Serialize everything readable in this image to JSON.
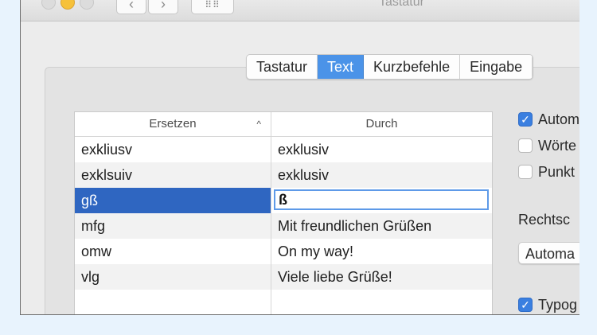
{
  "window": {
    "title": "Tastatur",
    "nav_back_icon": "‹",
    "nav_forward_icon": "›",
    "grid_icon": "⠿⠿"
  },
  "tabs": [
    {
      "label": "Tastatur",
      "selected": false
    },
    {
      "label": "Text",
      "selected": true
    },
    {
      "label": "Kurzbefehle",
      "selected": false
    },
    {
      "label": "Eingabe",
      "selected": false
    }
  ],
  "table": {
    "headers": {
      "replace": "Ersetzen",
      "with": "Durch"
    },
    "sort_icon": "^",
    "rows": [
      {
        "replace": "exkliusv",
        "with": "exklusiv"
      },
      {
        "replace": "exklsuiv",
        "with": "exklusiv"
      },
      {
        "replace": "gß",
        "with": "ß",
        "selected": true,
        "editing": true
      },
      {
        "replace": "mfg",
        "with": "Mit freundlichen Grüßen"
      },
      {
        "replace": "omw",
        "with": "On my way!"
      },
      {
        "replace": "vlg",
        "with": "Viele liebe Grüße!"
      },
      {
        "replace": "",
        "with": ""
      }
    ]
  },
  "options": [
    {
      "label": "Autom",
      "checked": true
    },
    {
      "label": "Wörte",
      "checked": false
    },
    {
      "label": "Punkt",
      "checked": false
    }
  ],
  "spelling": {
    "label": "Rechtsc",
    "popup_value": "Automa"
  },
  "typography": {
    "label": "Typog",
    "checked": true
  },
  "colors": {
    "accent": "#4b93e8",
    "selection": "#2f66c1",
    "background": "#e8f3fd"
  }
}
